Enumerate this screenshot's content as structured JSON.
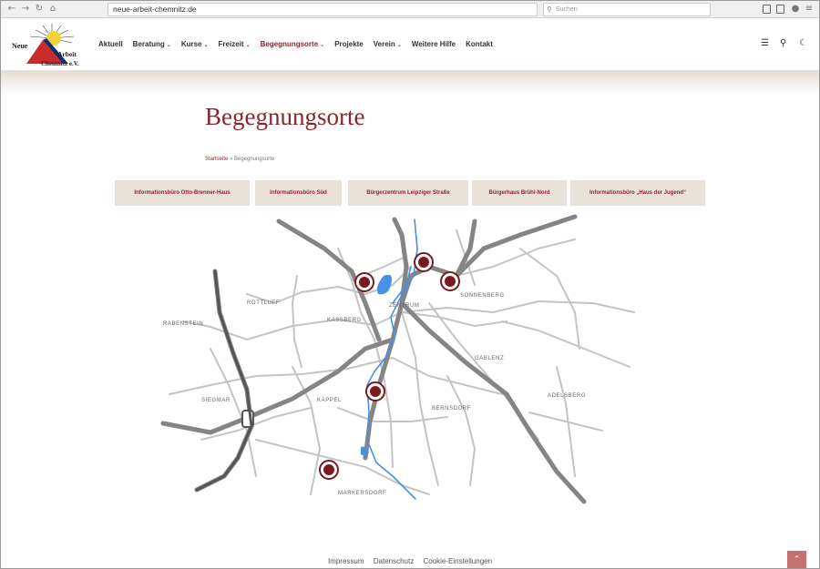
{
  "browser": {
    "url": "neue-arbeit-chemnitz.de",
    "search_placeholder": "Suchen"
  },
  "logo": {
    "line1": "Neue",
    "line2": "Arbeit",
    "line3": "Chemnitz e.V."
  },
  "nav": {
    "items": [
      {
        "label": "Aktuell",
        "dropdown": false
      },
      {
        "label": "Beratung",
        "dropdown": true
      },
      {
        "label": "Kurse",
        "dropdown": true
      },
      {
        "label": "Freizeit",
        "dropdown": true
      },
      {
        "label": "Begegnungsorte",
        "dropdown": true,
        "active": true
      },
      {
        "label": "Projekte",
        "dropdown": false
      },
      {
        "label": "Verein",
        "dropdown": true
      },
      {
        "label": "Weitere Hilfe",
        "dropdown": false
      },
      {
        "label": "Kontakt",
        "dropdown": false
      }
    ]
  },
  "page": {
    "title": "Begegnungsorte",
    "breadcrumb_home": "Startseite",
    "breadcrumb_sep": "»",
    "breadcrumb_current": "Begegnungsorte"
  },
  "tabs": [
    "Informationsbüro Otto-Brenner-Haus",
    "Informationsbüro Süd",
    "Bürgerzentrum Leipziger Straße",
    "Bürgerhaus Brühl-Nord",
    "Informationsbüro „Haus der Jugend“"
  ],
  "map": {
    "districts": [
      "RABENSTEIN",
      "ROTTLUFF",
      "KASSBERG",
      "ZENTRUM",
      "SONNENBERG",
      "GABLENZ",
      "SIEGMAR",
      "KAPPEL",
      "BERNSDORF",
      "ADELSBERG",
      "MARKERSDORF"
    ],
    "colors": {
      "marker": "#7a1a1f",
      "water": "#4a90e2",
      "road_major": "#858585",
      "road_minor": "#c4c4c4"
    }
  },
  "footer": {
    "links": [
      "Impressum",
      "Datenschutz",
      "Cookie-Einstellungen"
    ]
  },
  "colors": {
    "accent": "#8b2530",
    "tab_bg": "#e9e2d9"
  }
}
